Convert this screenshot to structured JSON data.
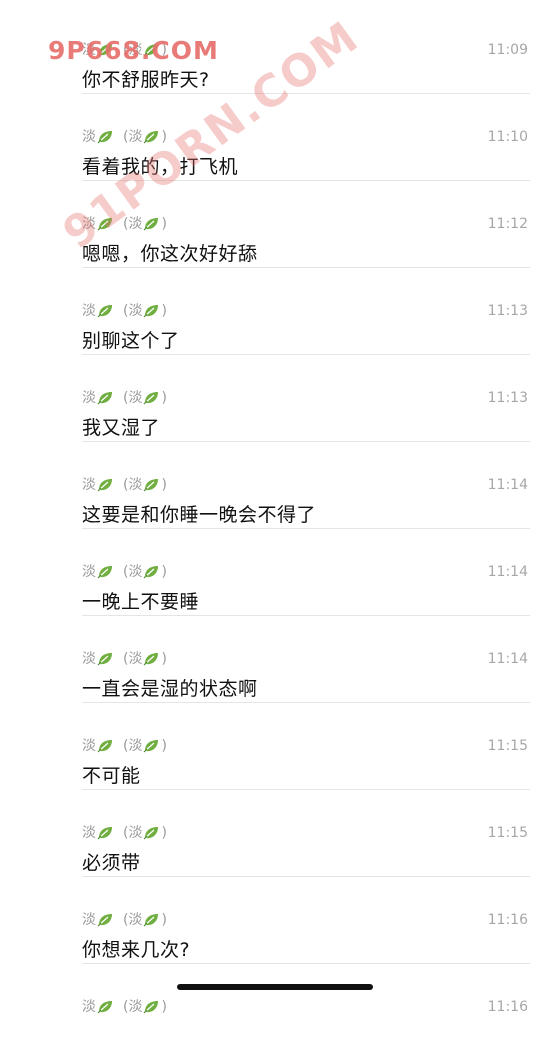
{
  "watermarks": {
    "main": "9P668.COM",
    "diagonal": "91PORN.COM"
  },
  "messages": [
    {
      "sender": "淡",
      "sender_paren": "(淡",
      "time": "11:09",
      "text": "你不舒服昨天?"
    },
    {
      "sender": "淡",
      "sender_paren": "(淡",
      "time": "11:10",
      "text": "看着我的，打飞机"
    },
    {
      "sender": "淡",
      "sender_paren": "(淡",
      "time": "11:12",
      "text": "嗯嗯，你这次好好舔"
    },
    {
      "sender": "淡",
      "sender_paren": "(淡",
      "time": "11:13",
      "text": "别聊这个了"
    },
    {
      "sender": "淡",
      "sender_paren": "(淡",
      "time": "11:13",
      "text": "我又湿了"
    },
    {
      "sender": "淡",
      "sender_paren": "(淡",
      "time": "11:14",
      "text": "这要是和你睡一晚会不得了"
    },
    {
      "sender": "淡",
      "sender_paren": "(淡",
      "time": "11:14",
      "text": "一晚上不要睡"
    },
    {
      "sender": "淡",
      "sender_paren": "(淡",
      "time": "11:14",
      "text": "一直会是湿的状态啊"
    },
    {
      "sender": "淡",
      "sender_paren": "(淡",
      "time": "11:15",
      "text": "不可能"
    },
    {
      "sender": "淡",
      "sender_paren": "(淡",
      "time": "11:15",
      "text": "必须带"
    },
    {
      "sender": "淡",
      "sender_paren": "(淡",
      "time": "11:16",
      "text": "你想来几次?"
    },
    {
      "sender": "淡",
      "sender_paren": "(淡",
      "time": "11:16",
      "text": ""
    }
  ],
  "icons": {
    "sender_emoji": "leaf-icon"
  },
  "colors": {
    "watermark": "#e7706c",
    "leaf": "#6fae3f",
    "time": "#a7a7a7",
    "divider": "#e5e5e5"
  }
}
